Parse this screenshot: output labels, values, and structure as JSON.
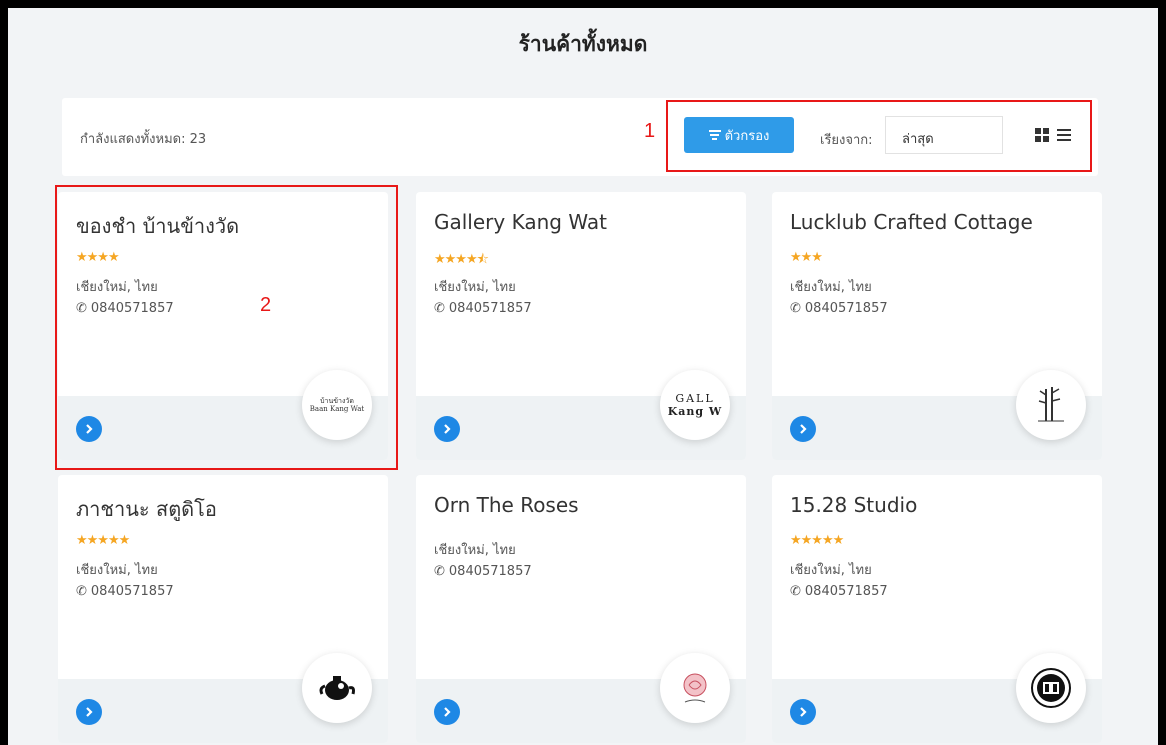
{
  "page": {
    "title": "ร้านค้าทั้งหมด"
  },
  "toolbar": {
    "count_text": "กำลังแสดงทั้งหมด: 23",
    "filter_label": "ตัวกรอง",
    "sort_label": "เรียงจาก:",
    "sort_value": "ล่าสุด"
  },
  "annotations": {
    "one": "1",
    "two": "2"
  },
  "colors": {
    "accent": "#2f9be8",
    "go_button": "#1e88e5",
    "stars": "#f5a623",
    "annotation": "#e81818"
  },
  "shops": [
    {
      "name": "ของชำ บ้านข้างวัด",
      "stars": "★★★★",
      "location": "เชียงใหม่, ไทย",
      "phone": "0840571857",
      "logo_text": "บ้านข้างวัด",
      "logo_sub": "Baan Kang Wat"
    },
    {
      "name": "Gallery Kang Wat",
      "stars": "★★★★⯪",
      "location": "เชียงใหม่, ไทย",
      "phone": "0840571857",
      "logo_text": "GALL",
      "logo_sub": "Kang W"
    },
    {
      "name": "Lucklub Crafted Cottage",
      "stars": "★★★",
      "location": "เชียงใหม่, ไทย",
      "phone": "0840571857",
      "logo_text": "",
      "logo_sub": ""
    },
    {
      "name": "ภาชานะ สตูดิโอ",
      "stars": "★★★★★",
      "location": "เชียงใหม่, ไทย",
      "phone": "0840571857",
      "logo_text": "",
      "logo_sub": ""
    },
    {
      "name": "Orn The Roses",
      "stars": "",
      "location": "เชียงใหม่, ไทย",
      "phone": "0840571857",
      "logo_text": "",
      "logo_sub": ""
    },
    {
      "name": "15.28 Studio",
      "stars": "★★★★★",
      "location": "เชียงใหม่, ไทย",
      "phone": "0840571857",
      "logo_text": "",
      "logo_sub": ""
    }
  ],
  "icons": {
    "filter": "filter-icon",
    "grid": "grid-view-icon",
    "list": "list-view-icon",
    "phone": "phone-icon",
    "go": "chevron-right-icon"
  }
}
